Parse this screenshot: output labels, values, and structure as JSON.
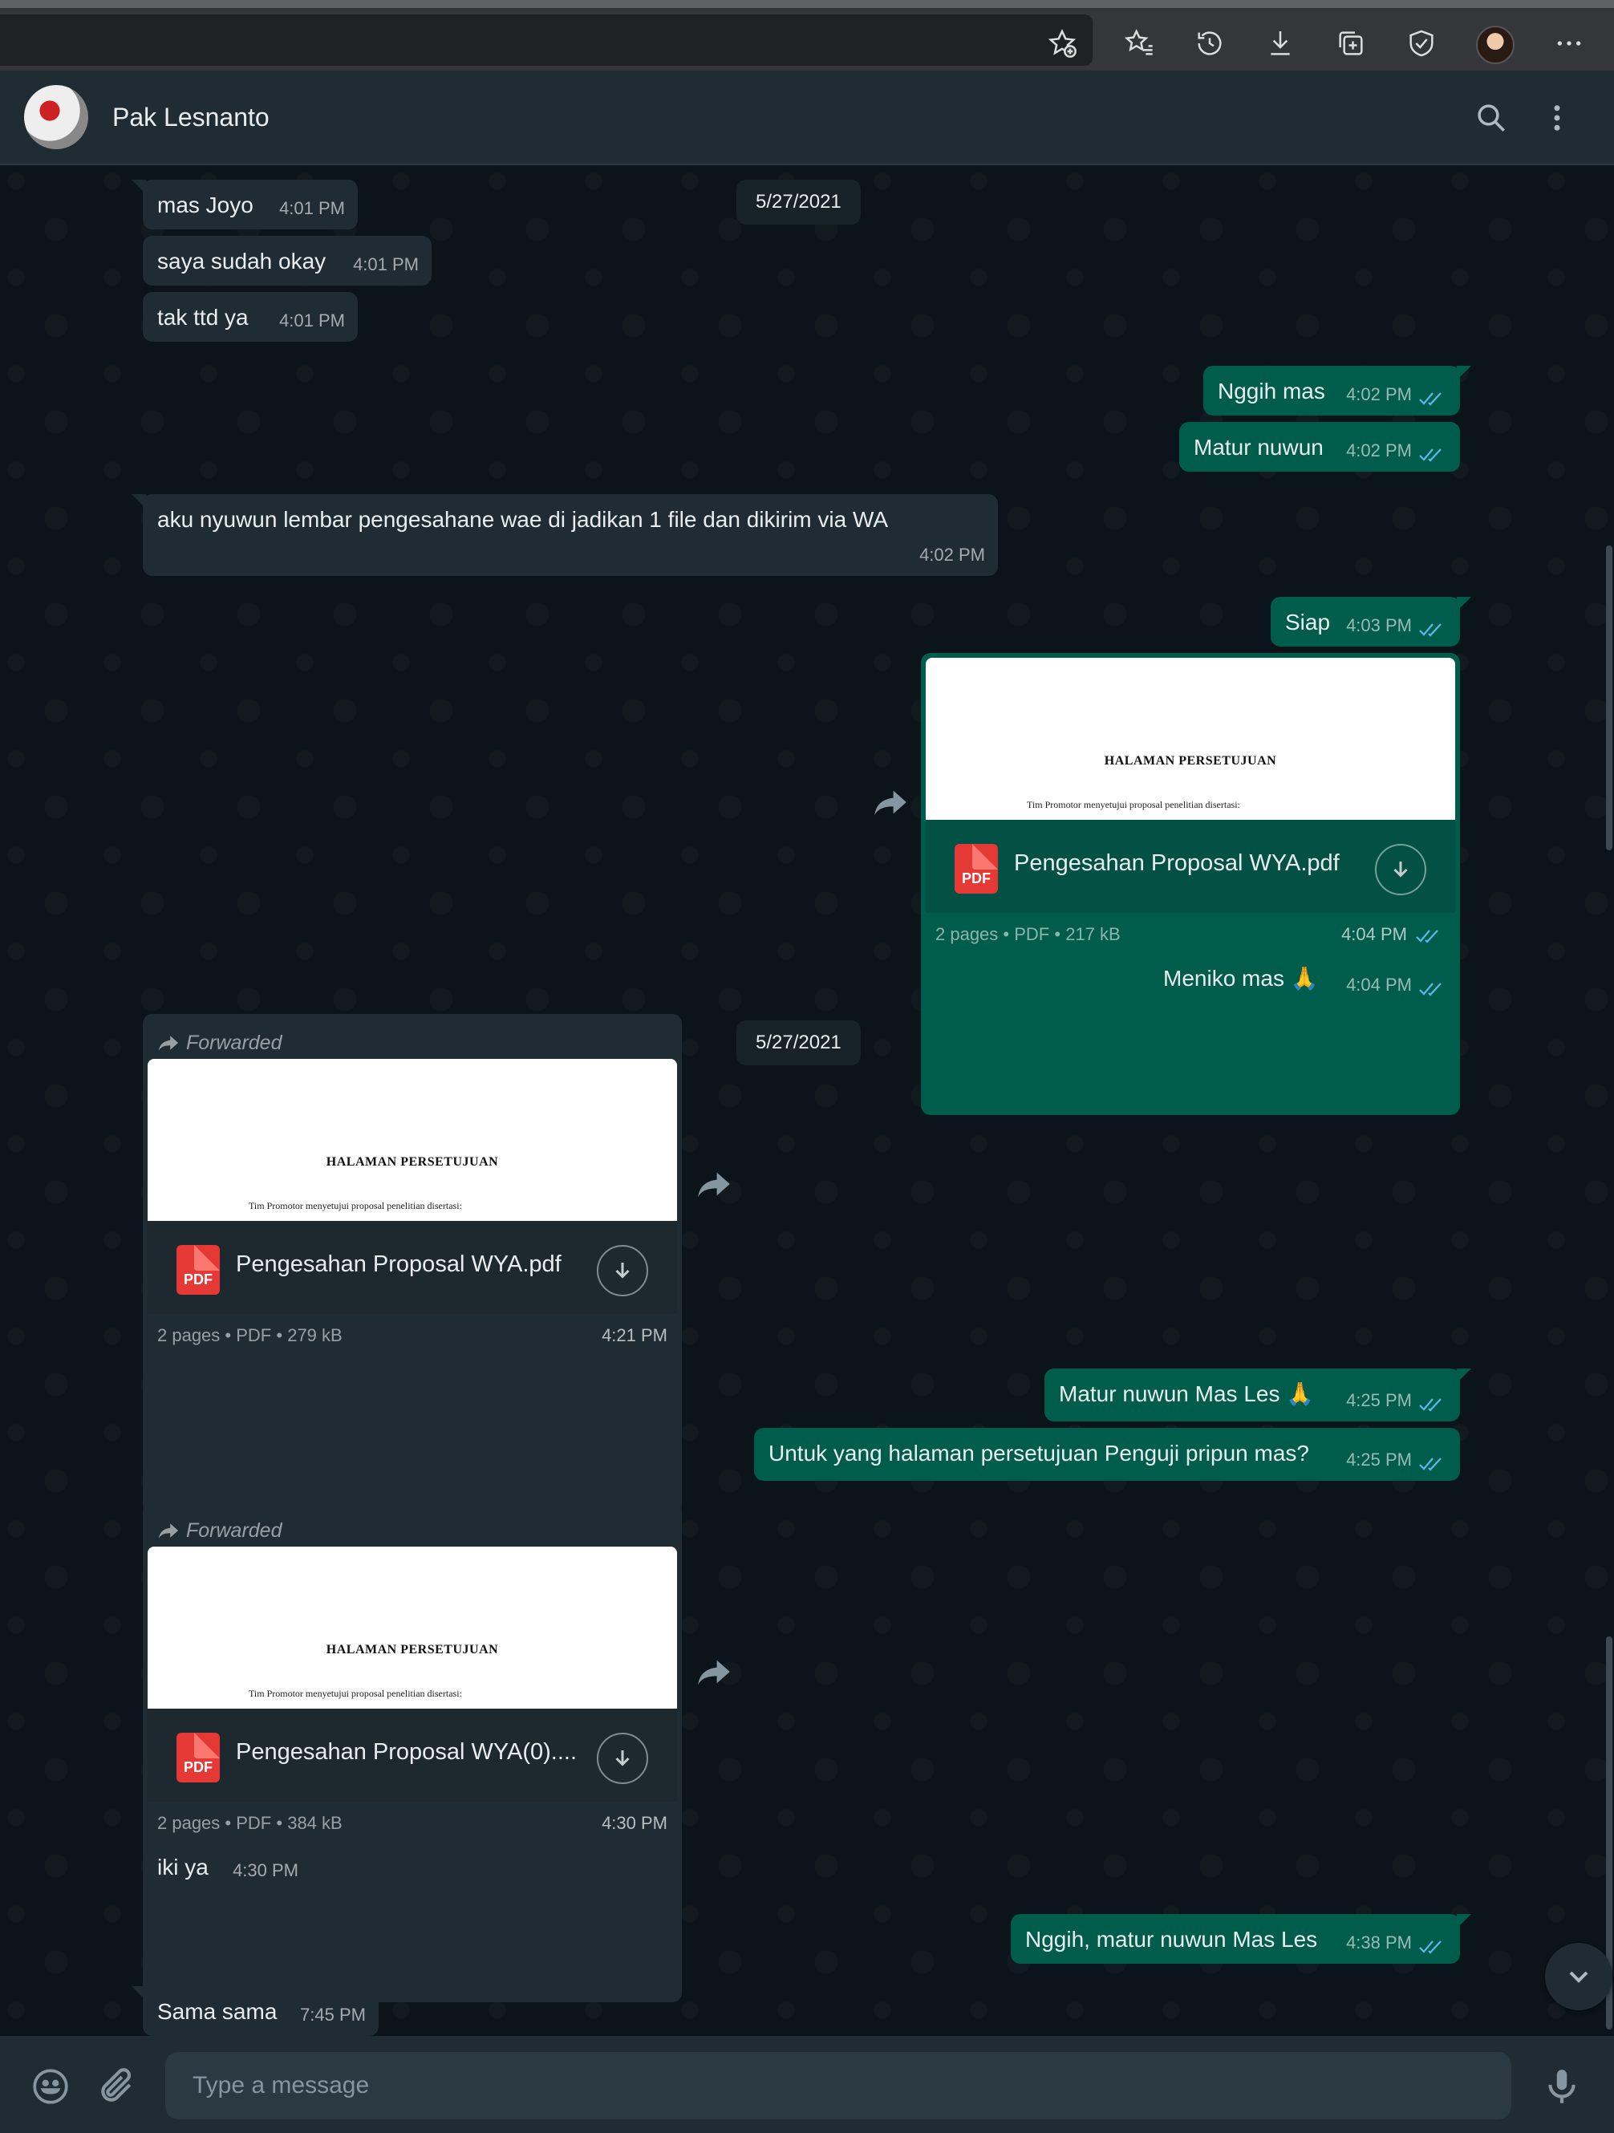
{
  "browser": {
    "icons": [
      "add-favorite-icon",
      "favorites-icon",
      "history-icon",
      "downloads-icon",
      "collections-icon",
      "browser-essentials-icon",
      "profile-avatar",
      "more-icon"
    ]
  },
  "header": {
    "contact_name": "Pak Lesnanto",
    "icons": [
      "search-icon",
      "menu-icon"
    ]
  },
  "colors": {
    "incoming_bubble": "#202c33",
    "outgoing_bubble": "#005c4b",
    "read_ticks": "#53bdeb",
    "background": "#0b141a"
  },
  "messages": [
    {
      "dir": "in",
      "text": "mas Joyo",
      "time": "4:01 PM"
    },
    {
      "dir": "in",
      "text": "saya sudah okay",
      "time": "4:01 PM"
    },
    {
      "dir": "in",
      "text": "tak ttd ya",
      "time": "4:01 PM"
    },
    {
      "dir": "out",
      "text": "Nggih mas",
      "time": "4:02 PM"
    },
    {
      "dir": "out",
      "text": "Matur nuwun",
      "time": "4:02 PM"
    },
    {
      "dir": "in",
      "text": "aku nyuwun lembar pengesahane wae di jadikan 1 file dan dikirim via WA",
      "time": "4:02 PM"
    },
    {
      "dir": "out",
      "text": "Siap",
      "time": "4:03 PM"
    },
    {
      "dir": "out",
      "text": "Meniko mas 🙏",
      "time": "4:04 PM"
    },
    {
      "dir": "out",
      "text": "Matur nuwun Mas Les 🙏",
      "time": "4:25 PM"
    },
    {
      "dir": "out",
      "text": "Untuk yang halaman persetujuan Penguji pripun mas?",
      "time": "4:25 PM"
    },
    {
      "dir": "in",
      "text": "iki ya",
      "time": "4:30 PM"
    },
    {
      "dir": "out",
      "text": "Nggih, matur nuwun Mas Les",
      "time": "4:38 PM"
    },
    {
      "dir": "in",
      "text": "Sama sama",
      "time": "7:45 PM"
    }
  ],
  "documents": [
    {
      "dir": "out",
      "forwarded": false,
      "name": "Pengesahan Proposal WYA.pdf",
      "pages": "2 pages",
      "type": "PDF",
      "size": "217 kB",
      "time": "4:04 PM",
      "preview_title": "HALAMAN PERSETUJUAN",
      "preview_sub": "Tim Promotor menyetujui proposal penelitian disertasi:"
    },
    {
      "dir": "in",
      "forwarded": true,
      "forwarded_label": "Forwarded",
      "name": "Pengesahan Proposal WYA.pdf",
      "pages": "2 pages",
      "type": "PDF",
      "size": "279 kB",
      "time": "4:21 PM",
      "preview_title": "HALAMAN PERSETUJUAN",
      "preview_sub": "Tim Promotor menyetujui proposal penelitian disertasi:"
    },
    {
      "dir": "in",
      "forwarded": true,
      "forwarded_label": "Forwarded",
      "name": "Pengesahan Proposal WYA(0)....",
      "pages": "2 pages",
      "type": "PDF",
      "size": "384 kB",
      "time": "4:30 PM",
      "preview_title": "HALAMAN PERSETUJUAN",
      "preview_sub": "Tim Promotor menyetujui proposal penelitian disertasi:"
    }
  ],
  "pdf_badge": "PDF",
  "meta_separator": "•",
  "date_chips": [
    "5/27/2021",
    "5/27/2021"
  ],
  "footer": {
    "placeholder": "Type a message",
    "icons": [
      "emoji-icon",
      "attach-icon",
      "microphone-icon"
    ]
  }
}
